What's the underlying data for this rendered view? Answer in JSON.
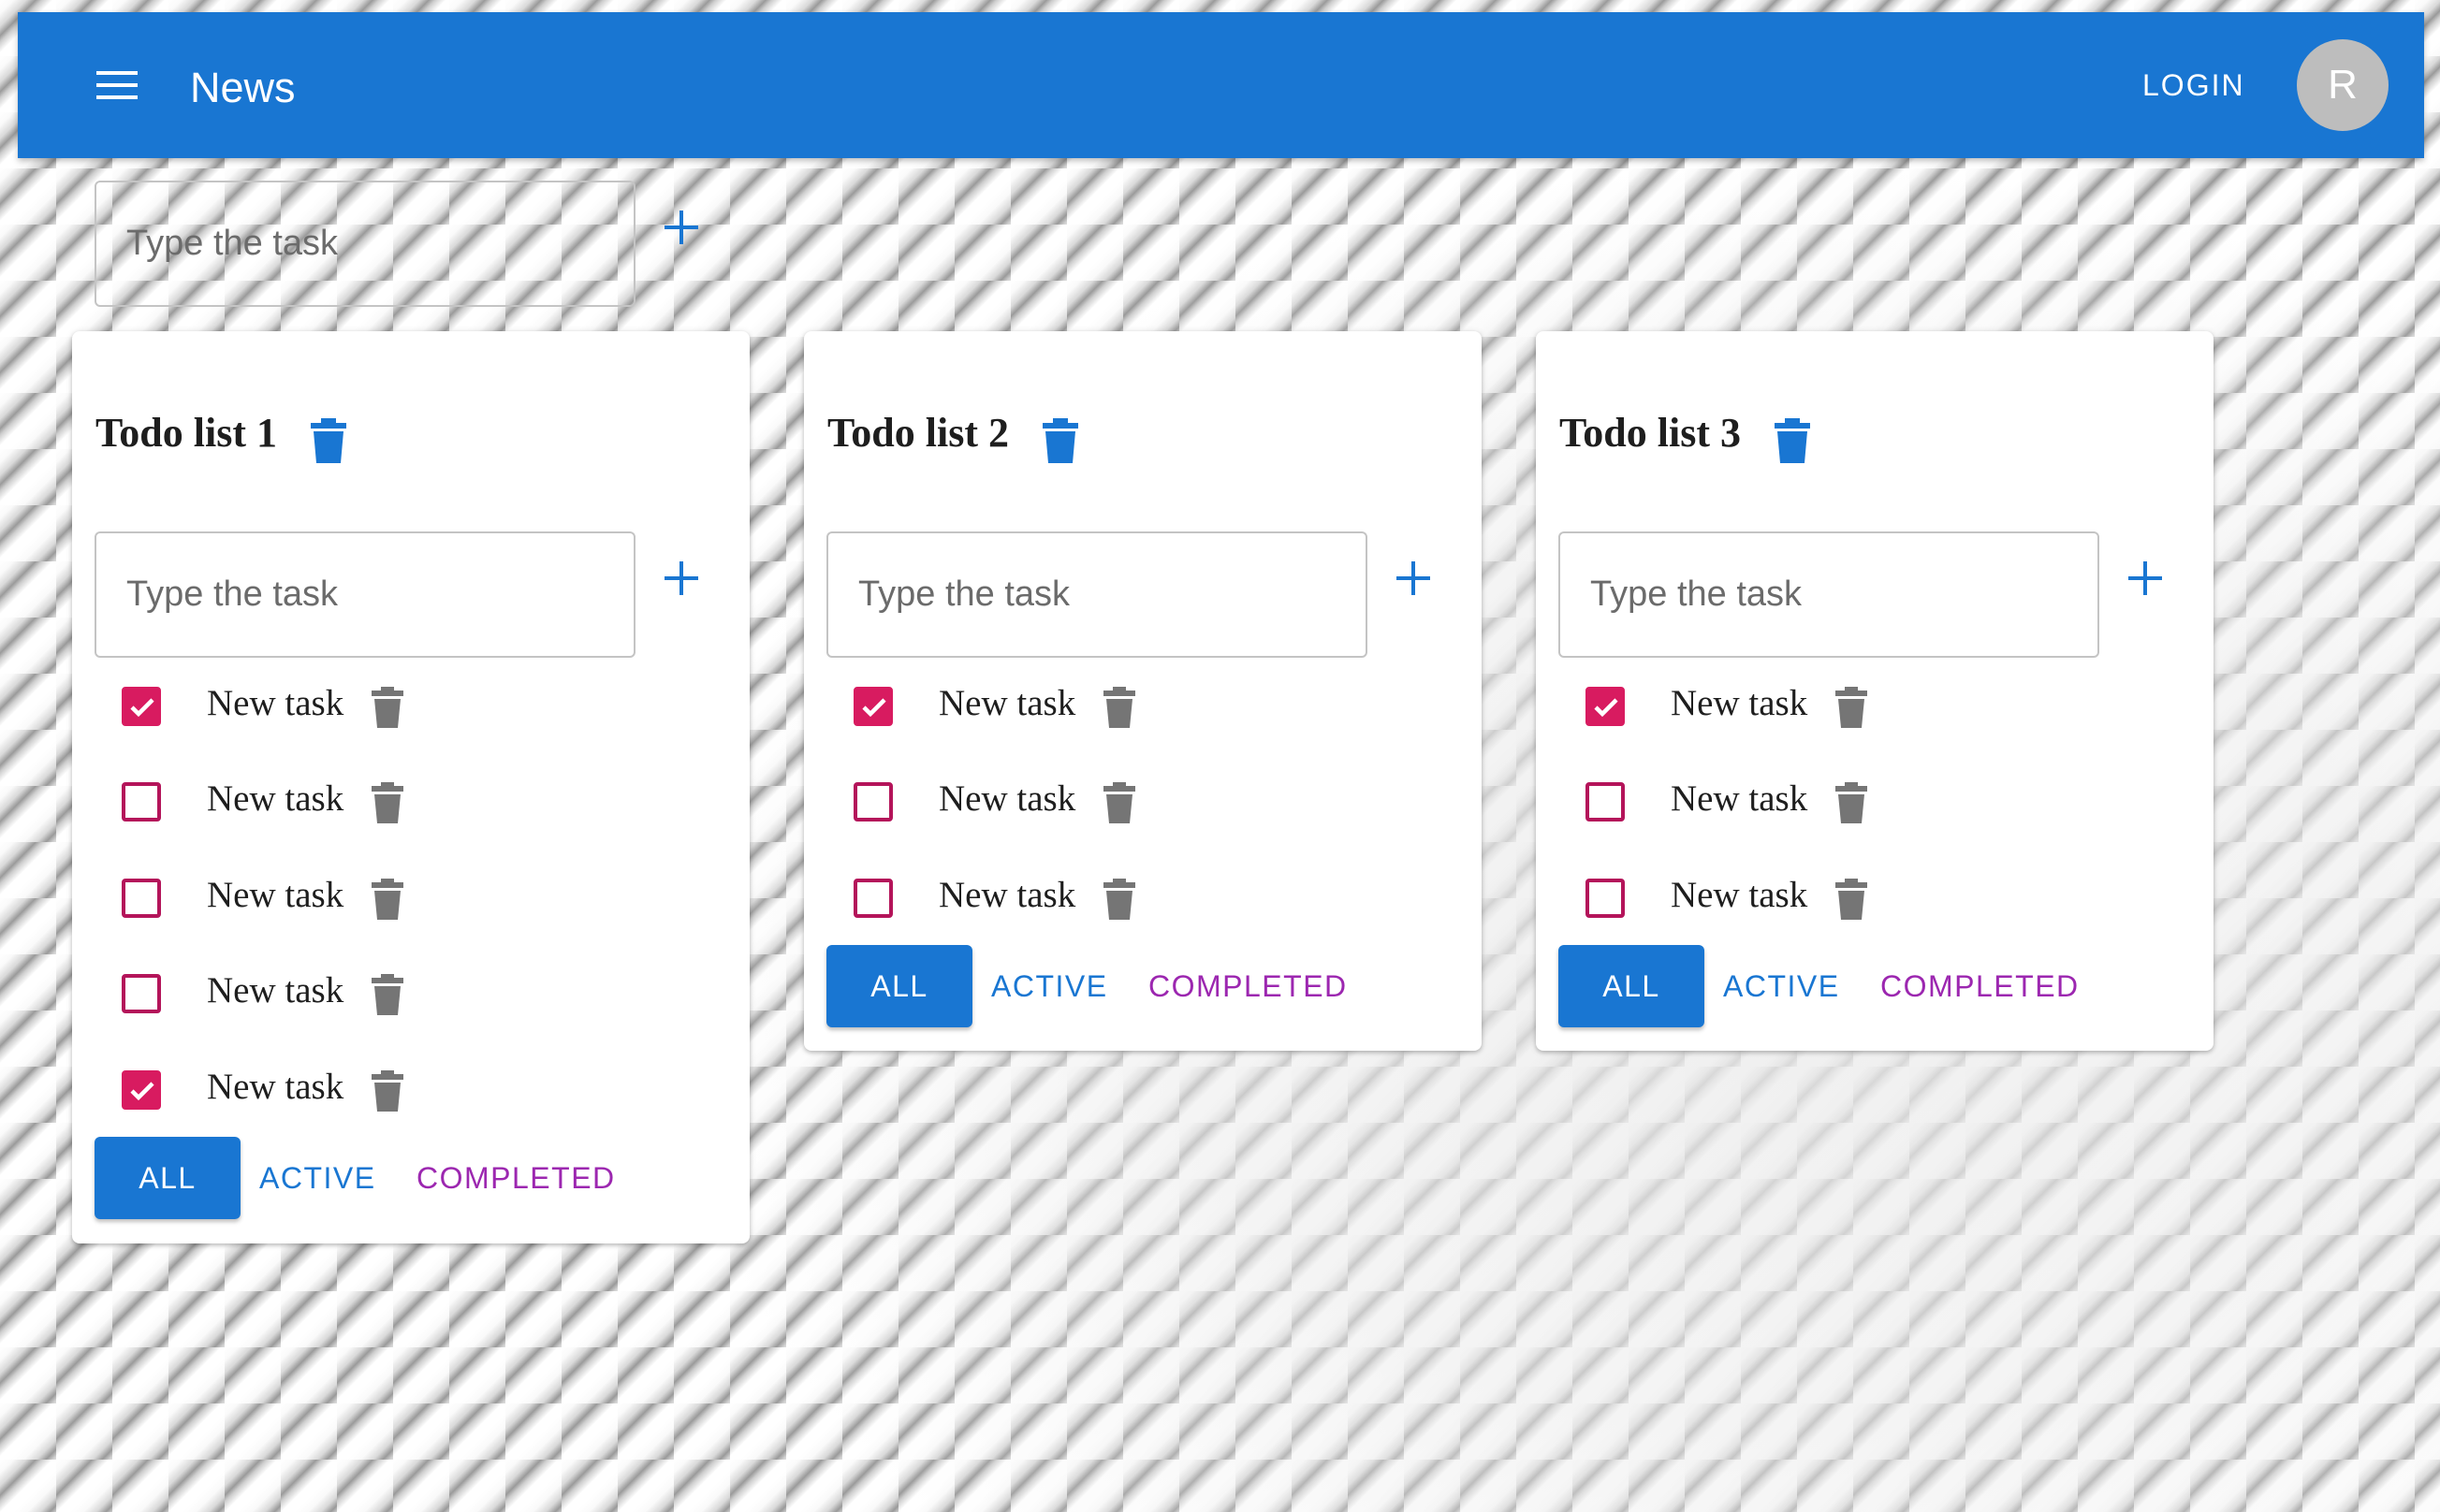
{
  "appbar": {
    "title": "News",
    "login_label": "LOGIN",
    "avatar_letter": "R",
    "color": "#1976d2"
  },
  "add_list": {
    "placeholder": "Type the task"
  },
  "todolists": [
    {
      "title": "Todo list 1",
      "input_placeholder": "Type the task",
      "tasks": [
        {
          "label": "New task",
          "done": true
        },
        {
          "label": "New task",
          "done": false
        },
        {
          "label": "New task",
          "done": false
        },
        {
          "label": "New task",
          "done": false
        },
        {
          "label": "New task",
          "done": true
        }
      ],
      "filters": {
        "all": "ALL",
        "active": "ACTIVE",
        "completed": "COMPLETED"
      }
    },
    {
      "title": "Todo list 2",
      "input_placeholder": "Type the task",
      "tasks": [
        {
          "label": "New task",
          "done": true
        },
        {
          "label": "New task",
          "done": false
        },
        {
          "label": "New task",
          "done": false
        }
      ],
      "filters": {
        "all": "ALL",
        "active": "ACTIVE",
        "completed": "COMPLETED"
      }
    },
    {
      "title": "Todo list 3",
      "input_placeholder": "Type the task",
      "tasks": [
        {
          "label": "New task",
          "done": true
        },
        {
          "label": "New task",
          "done": false
        },
        {
          "label": "New task",
          "done": false
        }
      ],
      "filters": {
        "all": "ALL",
        "active": "ACTIVE",
        "completed": "COMPLETED"
      }
    }
  ],
  "icons": {
    "menu": "menu-icon",
    "add": "plus-icon",
    "delete": "trash-icon",
    "check": "check-icon"
  },
  "colors": {
    "primary": "#1976d2",
    "checkbox": "#d81b60",
    "completed_text": "#9c27b0",
    "task_trash": "#757575"
  }
}
